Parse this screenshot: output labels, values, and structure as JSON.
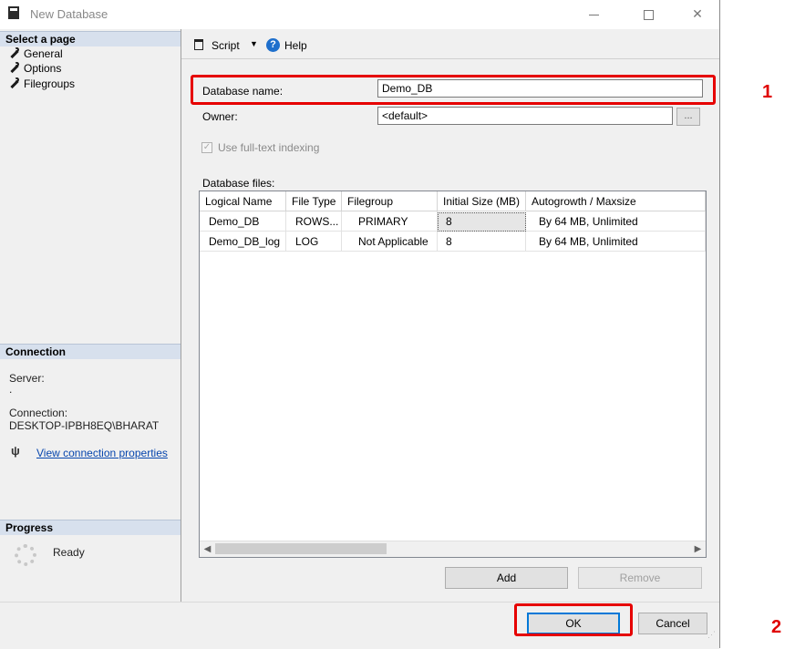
{
  "window": {
    "title": "New Database",
    "min_symbol": "—",
    "max_symbol": "☐",
    "close_symbol": "✕"
  },
  "left_pane": {
    "select_page_header": "Select a page",
    "pages": [
      {
        "label": "General"
      },
      {
        "label": "Options"
      },
      {
        "label": "Filegroups"
      }
    ],
    "connection": {
      "header": "Connection",
      "server_label": "Server:",
      "server_value": ".",
      "connection_label": "Connection:",
      "connection_value": "DESKTOP-IPBH8EQ\\BHARAT",
      "view_properties_link": "View connection properties"
    },
    "progress": {
      "header": "Progress",
      "status": "Ready"
    }
  },
  "toolbar": {
    "script_label": "Script",
    "help_label": "Help"
  },
  "general": {
    "database_name_label": "Database name:",
    "database_name_value": "Demo_DB",
    "owner_label": "Owner:",
    "owner_value": "<default>",
    "owner_browse_label": "...",
    "fulltext_label": "Use full-text indexing",
    "fulltext_checked": true,
    "database_files_label": "Database files:"
  },
  "files_grid": {
    "columns": [
      "Logical Name",
      "File Type",
      "Filegroup",
      "Initial Size (MB)",
      "Autogrowth / Maxsize"
    ],
    "rows": [
      [
        "Demo_DB",
        "ROWS...",
        "PRIMARY",
        "8",
        "By 64 MB, Unlimited"
      ],
      [
        "Demo_DB_log",
        "LOG",
        "Not Applicable",
        "8",
        "By 64 MB, Unlimited"
      ]
    ]
  },
  "buttons": {
    "add": "Add",
    "remove": "Remove",
    "ok": "OK",
    "cancel": "Cancel"
  },
  "annotations": {
    "step1": "1",
    "step2": "2"
  },
  "colors": {
    "highlight": "#e60000",
    "pane_header": "#d7e0ed",
    "link": "#0645ad",
    "help_icon": "#1e6fcc"
  }
}
